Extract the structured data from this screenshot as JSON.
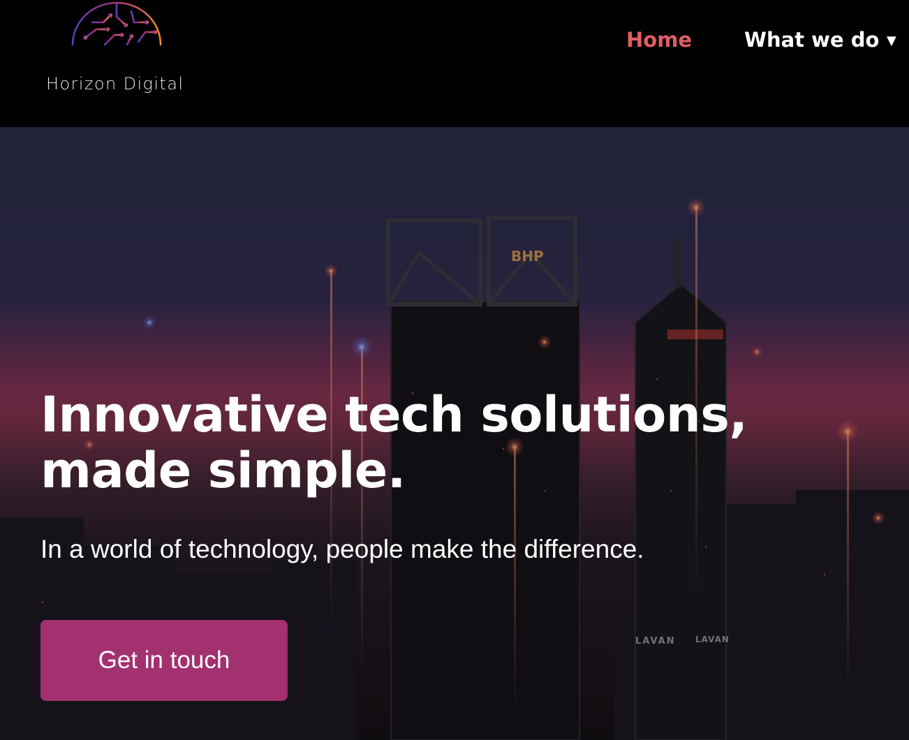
{
  "brand": {
    "name": "Horizon Digital",
    "logo_icon": "circuit-sunrise-logo",
    "logo_colors": [
      "#5b3db8",
      "#a8307a",
      "#e4593f",
      "#f08a3c"
    ]
  },
  "nav": {
    "items": [
      {
        "label": "Home",
        "active": true
      },
      {
        "label": "What we do",
        "has_dropdown": true
      }
    ],
    "dropdown_icon": "caret-down-icon",
    "active_color": "#e25d64"
  },
  "hero": {
    "title_line1": "Innovative tech solutions,",
    "title_line2": "made simple.",
    "subtitle": "In a world of technology, people make the difference.",
    "cta_label": "Get in touch",
    "cta_color": "#a3306f",
    "background": "night-city-skyline-image",
    "signage": [
      "BHP",
      "LAVAN",
      "LAVAN"
    ]
  }
}
